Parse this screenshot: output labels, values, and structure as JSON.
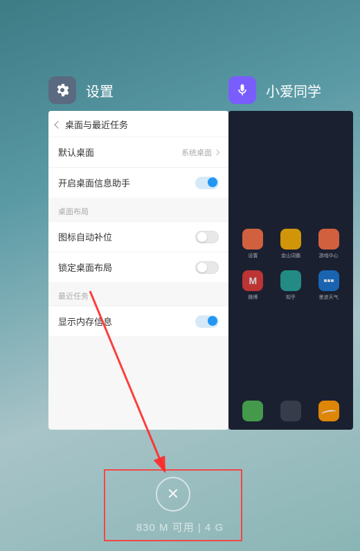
{
  "apps": {
    "settings_title": "设置",
    "xiaoai_title": "小爱同学"
  },
  "settings": {
    "breadcrumb": "桌面与最近任务",
    "default_home": {
      "label": "默认桌面",
      "value": "系统桌面"
    },
    "info_assistant_label": "开启桌面信息助手",
    "section_layout": "桌面布局",
    "auto_fill_label": "图标自动补位",
    "lock_layout_label": "锁定桌面布局",
    "section_recent": "最近任务",
    "show_memory_label": "显示内存信息"
  },
  "home_labels": {
    "r1a": "设置",
    "r1b": "金山词霸",
    "r1c": "游戏中心",
    "r2a": "微博",
    "r2b": "知乎",
    "r2c": "墨迹天气"
  },
  "memory": {
    "text": "830 M 可用 | 4 G"
  }
}
